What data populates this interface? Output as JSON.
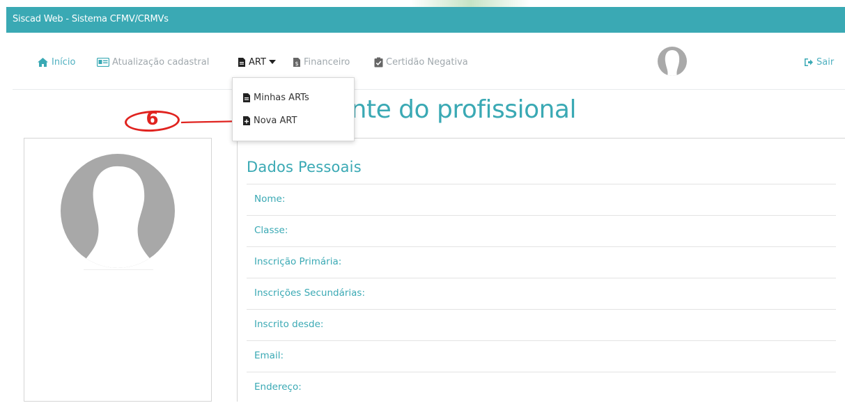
{
  "window": {
    "title": "Siscad Web - Sistema CFMV/CRMVs"
  },
  "nav": {
    "items": [
      {
        "label": "Início",
        "icon": "home-icon"
      },
      {
        "label": "Atualização cadastral",
        "icon": "id-card-icon"
      },
      {
        "label": "ART",
        "icon": "file-icon"
      },
      {
        "label": "Financeiro",
        "icon": "money-file-icon"
      },
      {
        "label": "Certidão Negativa",
        "icon": "clipboard-check-icon"
      }
    ],
    "logout": {
      "label": "Sair",
      "icon": "sign-out-icon"
    }
  },
  "dropdown": {
    "items": [
      {
        "label": "Minhas ARTs",
        "icon": "file-icon"
      },
      {
        "label": "Nova ART",
        "icon": "file-plus-icon"
      }
    ]
  },
  "annotation": {
    "number": "6"
  },
  "page": {
    "heading": "ente do profissional"
  },
  "personal": {
    "section_title": "Dados Pessoais",
    "fields": [
      {
        "label": "Nome:"
      },
      {
        "label": "Classe:"
      },
      {
        "label": "Inscrição Primária:"
      },
      {
        "label": "Inscrições Secundárias:"
      },
      {
        "label": "Inscrito desde:"
      },
      {
        "label": "Email:"
      },
      {
        "label": "Endereço:"
      }
    ]
  },
  "colors": {
    "brand": "#3aa9b4",
    "annotation": "#e0231f",
    "muted_text": "#a0a8ad"
  }
}
